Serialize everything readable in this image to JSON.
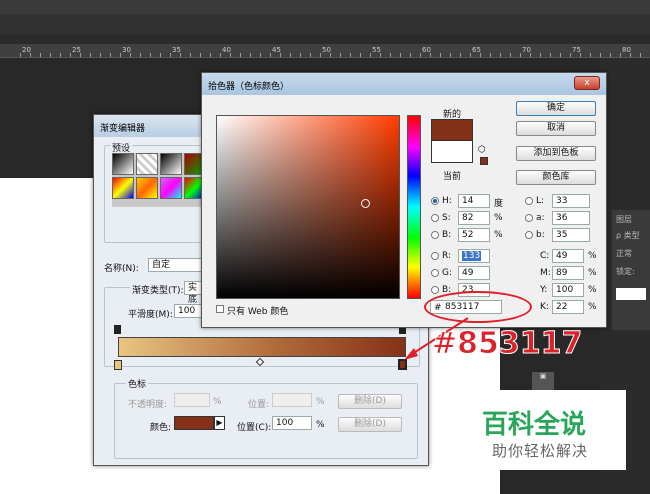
{
  "ruler": {
    "ticks": [
      "20",
      "25",
      "30",
      "35",
      "40",
      "45",
      "50",
      "55",
      "60",
      "65",
      "70",
      "75",
      "80"
    ]
  },
  "right_panel": {
    "tab": "图层",
    "filter": "ρ 类型",
    "blend": "正常",
    "lock": "锁定:"
  },
  "gradient_editor": {
    "title": "渐变编辑器",
    "presets_label": "预设",
    "name_label": "名称(N):",
    "name_value": "自定",
    "type_label": "渐变类型(T):",
    "type_value": "实底",
    "smooth_label": "平滑度(M):",
    "smooth_value": "100",
    "stops_label": "色标",
    "opacity_label": "不透明度:",
    "opacity_value": "",
    "opacity_unit": "%",
    "position_label": "位置:",
    "position_unit": "%",
    "delete_label": "删除(D)",
    "color_label": "颜色:",
    "position2_label": "位置(C):",
    "position2_value": "100",
    "position2_unit": "%",
    "delete2_label": "删除(D)"
  },
  "color_picker": {
    "title": "拾色器（色标颜色）",
    "close": "x",
    "new_label": "新的",
    "current_label": "当前",
    "ok": "确定",
    "cancel": "取消",
    "add_swatch": "添加到色板",
    "libraries": "颜色库",
    "web_only": "只有 Web 颜色",
    "fields": {
      "H": {
        "label": "H:",
        "value": "14",
        "unit": "度"
      },
      "S": {
        "label": "S:",
        "value": "82",
        "unit": "%"
      },
      "Bv": {
        "label": "B:",
        "value": "52",
        "unit": "%"
      },
      "R": {
        "label": "R:",
        "value": "133"
      },
      "G": {
        "label": "G:",
        "value": "49"
      },
      "B": {
        "label": "B:",
        "value": "23"
      },
      "L": {
        "label": "L:",
        "value": "33"
      },
      "a": {
        "label": "a:",
        "value": "36"
      },
      "b": {
        "label": "b:",
        "value": "35"
      },
      "C": {
        "label": "C:",
        "value": "49",
        "unit": "%"
      },
      "M": {
        "label": "M:",
        "value": "89",
        "unit": "%"
      },
      "Y": {
        "label": "Y:",
        "value": "100",
        "unit": "%"
      },
      "K": {
        "label": "K:",
        "value": "22",
        "unit": "%"
      }
    },
    "hash": "#",
    "hex": "853117",
    "new_color": "#853117"
  },
  "annotation": {
    "hex_big": "#853117"
  },
  "watermark": {
    "line1": "百科全说",
    "line2": "助你轻松解决"
  }
}
